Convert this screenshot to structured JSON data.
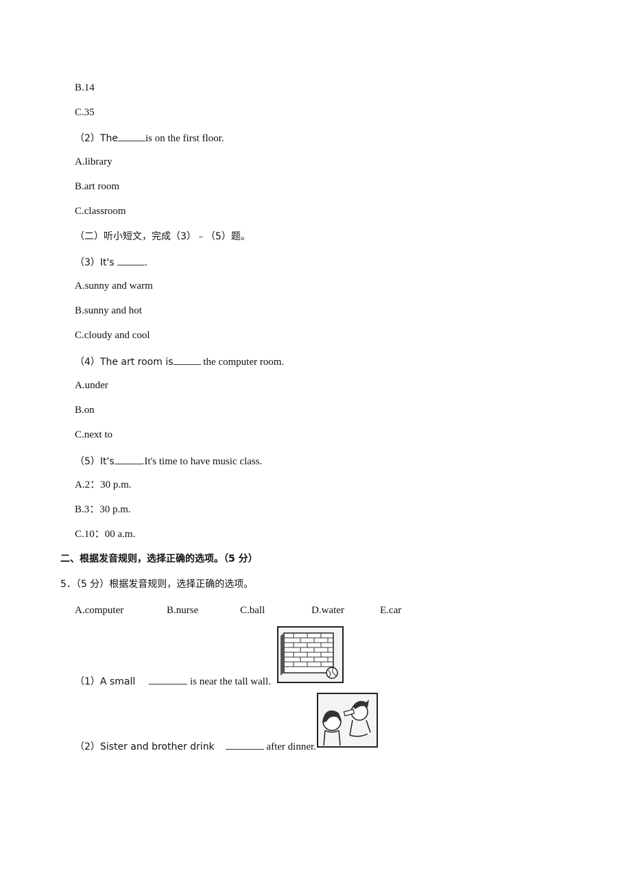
{
  "part1": {
    "q1_options": [
      "B.14",
      "C.35"
    ],
    "q2": {
      "prefix": "（2）The",
      "suffix": "is on the first floor."
    },
    "q2_options": [
      "A.library",
      "B.art room",
      "C.classroom"
    ],
    "sub_section": "（二）听小短文，完成（3）﹣（5）题。",
    "q3": {
      "prefix": "（3）It's ",
      "suffix": "."
    },
    "q3_options": [
      "A.sunny and warm",
      "B.sunny and hot",
      "C.cloudy and cool"
    ],
    "q4": {
      "prefix": "（4）The art room is",
      "suffix": " the computer room."
    },
    "q4_options": [
      "A.under",
      "B.on",
      "C.next to"
    ],
    "q5": {
      "prefix": "（5）It's",
      "suffix": ".It's time to have music class."
    },
    "q5_options": [
      "A.2：30 p.m.",
      "B.3：30 p.m.",
      "C.10：00 a.m."
    ]
  },
  "part2": {
    "heading": "二、根据发音规则，选择正确的选项。（5 分）",
    "question": "5．（5 分）根据发音规则，选择正确的选项。",
    "choices": [
      "A.computer",
      "B.nurse",
      "C.ball",
      "D.water",
      "E.car"
    ],
    "item1": {
      "prefix": "（1）A small",
      "suffix": " is near the tall wall.",
      "image": "wall-and-ball-picture"
    },
    "item2": {
      "prefix": "（2）Sister and brother drink",
      "suffix": " after dinner.",
      "image": "children-drinking-picture"
    }
  }
}
